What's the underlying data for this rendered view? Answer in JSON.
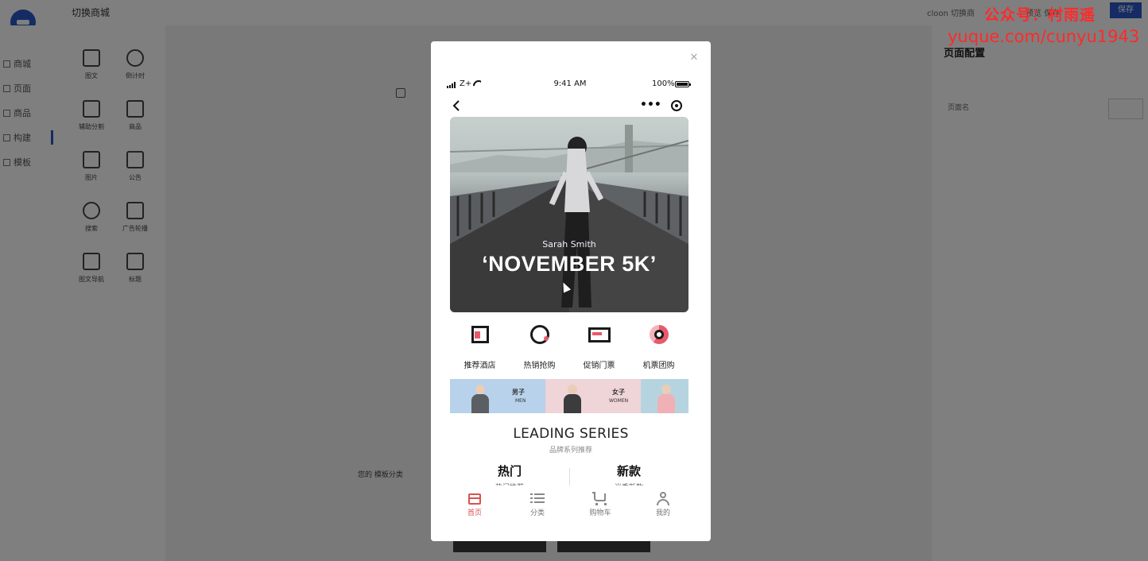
{
  "editor": {
    "app_title": "切换商城",
    "user_label": "cloon  切换商",
    "header_link": "预览  保存",
    "save_label": "保存",
    "nav_items": [
      {
        "label": "商城",
        "icon": "shop-icon"
      },
      {
        "label": "页面",
        "icon": "page-icon"
      },
      {
        "label": "商品",
        "icon": "goods-icon"
      },
      {
        "label": "构建",
        "icon": "build-icon",
        "active": true
      },
      {
        "label": "模板",
        "icon": "template-icon"
      }
    ],
    "components": [
      {
        "label": "图文",
        "icon": "grid-icon"
      },
      {
        "label": "倒计时",
        "icon": "timer-icon"
      },
      {
        "label": "辅助分割",
        "icon": "frame-icon"
      },
      {
        "label": "商品",
        "icon": "product-icon"
      },
      {
        "label": "图片",
        "icon": "image-icon"
      },
      {
        "label": "公告",
        "icon": "speaker-icon"
      },
      {
        "label": "搜索",
        "icon": "search-icon"
      },
      {
        "label": "广告轮播",
        "icon": "carousel-icon"
      },
      {
        "label": "图文导航",
        "icon": "nav-icon"
      },
      {
        "label": "标题",
        "icon": "title-icon"
      }
    ],
    "canvas_note": "您的 模板分类",
    "right_panel_title": "页面配置",
    "right_panel_field": "页面名",
    "watermark_line1": "公众号：村雨遥",
    "watermark_line2": "yuque.com/cunyu1943"
  },
  "preview": {
    "status": {
      "carrier": "Z+",
      "time": "9:41 AM",
      "battery": "100%"
    },
    "banner": {
      "author": "Sarah Smith",
      "title": "‘NOVEMBER 5K’"
    },
    "quick_nav": [
      {
        "label": "推荐酒店",
        "icon": "hotel-icon"
      },
      {
        "label": "热销抢购",
        "icon": "hot-sale-icon"
      },
      {
        "label": "促销门票",
        "icon": "ticket-icon"
      },
      {
        "label": "机票团购",
        "icon": "flight-icon"
      }
    ],
    "promo": {
      "men_cn": "男子",
      "men_en": "MEN",
      "women_cn": "女子",
      "women_en": "WOMEN"
    },
    "series_title": "LEADING SERIES",
    "series_sub": "品牌系列推荐",
    "columns": [
      {
        "title": "热门",
        "sub": "热门推荐"
      },
      {
        "title": "新款",
        "sub": "当季新款"
      }
    ],
    "tabs": [
      {
        "label": "首页",
        "icon": "home-icon",
        "active": true
      },
      {
        "label": "分类",
        "icon": "list-icon"
      },
      {
        "label": "购物车",
        "icon": "cart-icon"
      },
      {
        "label": "我的",
        "icon": "user-icon"
      }
    ],
    "accent_color": "#e85a6b"
  }
}
